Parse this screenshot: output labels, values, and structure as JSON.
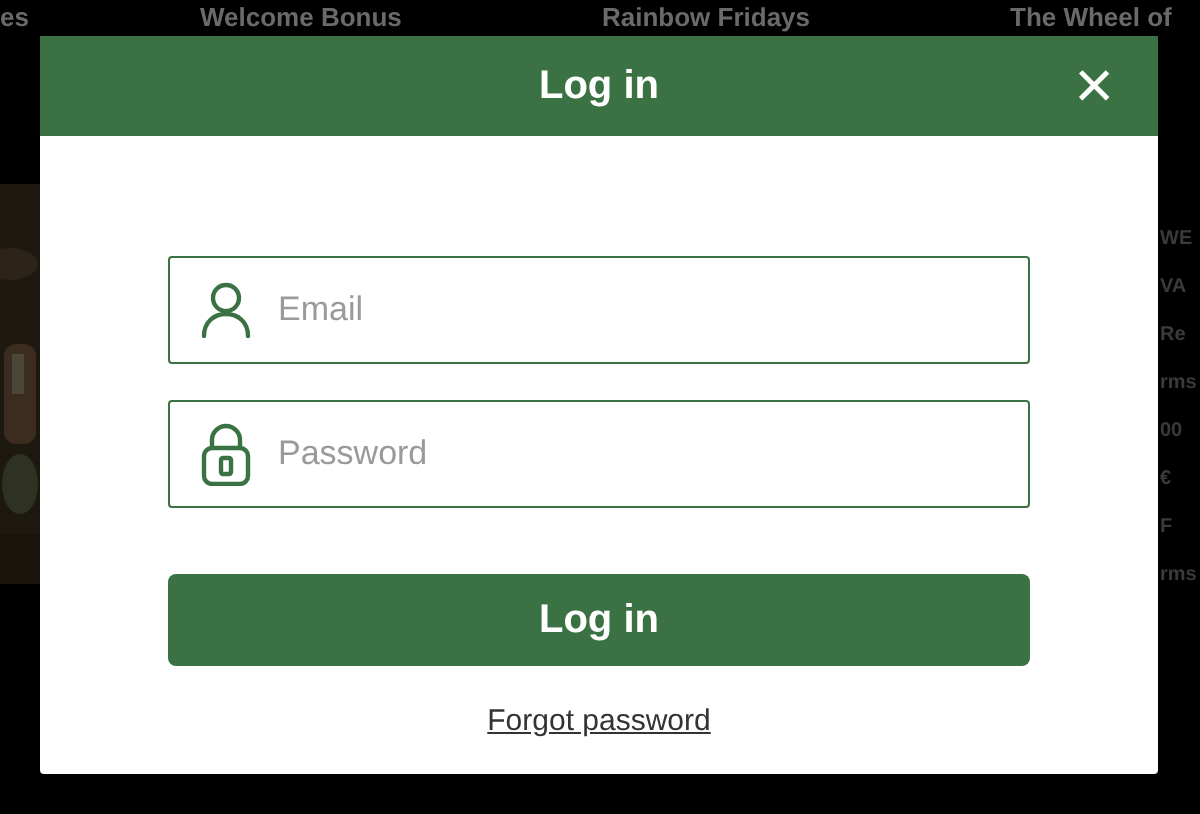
{
  "background": {
    "nav": [
      "es",
      "Welcome Bonus",
      "Rainbow Fridays",
      "The Wheel of"
    ],
    "side_fragments": [
      "WE",
      "VA",
      "Re",
      "rms",
      "00",
      "€",
      "F",
      "rms"
    ]
  },
  "modal": {
    "title": "Log in",
    "close": "×",
    "fields": [
      {
        "kind": "email",
        "placeholder": "Email"
      },
      {
        "kind": "password",
        "placeholder": "Password"
      }
    ],
    "submit": "Log in",
    "forgot": "Forgot password"
  }
}
